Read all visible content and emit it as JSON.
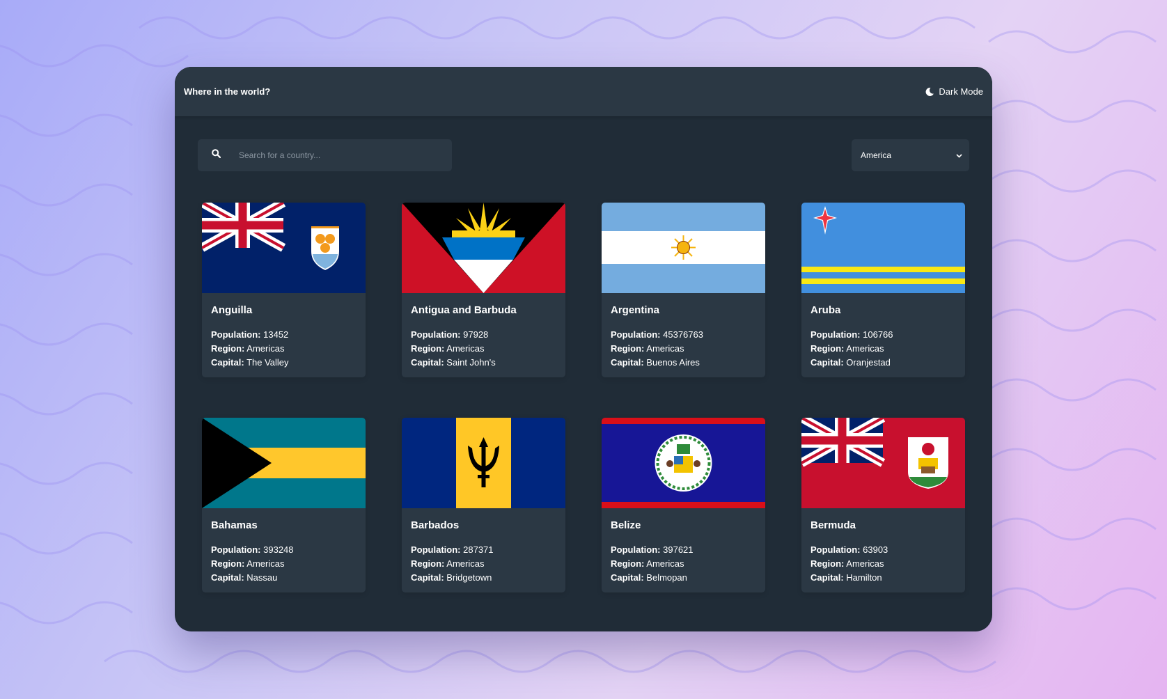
{
  "header": {
    "title": "Where in the world?",
    "mode_label": "Dark Mode"
  },
  "search": {
    "placeholder": "Search for a country..."
  },
  "filter": {
    "selected": "America"
  },
  "labels": {
    "population": "Population:",
    "region": "Region:",
    "capital": "Capital:"
  },
  "countries": [
    {
      "name": "Anguilla",
      "population": "13452",
      "region": "Americas",
      "capital": "The Valley"
    },
    {
      "name": "Antigua and Barbuda",
      "population": "97928",
      "region": "Americas",
      "capital": "Saint John's"
    },
    {
      "name": "Argentina",
      "population": "45376763",
      "region": "Americas",
      "capital": "Buenos Aires"
    },
    {
      "name": "Aruba",
      "population": "106766",
      "region": "Americas",
      "capital": "Oranjestad"
    },
    {
      "name": "Bahamas",
      "population": "393248",
      "region": "Americas",
      "capital": "Nassau"
    },
    {
      "name": "Barbados",
      "population": "287371",
      "region": "Americas",
      "capital": "Bridgetown"
    },
    {
      "name": "Belize",
      "population": "397621",
      "region": "Americas",
      "capital": "Belmopan"
    },
    {
      "name": "Bermuda",
      "population": "63903",
      "region": "Americas",
      "capital": "Hamilton"
    }
  ],
  "icons": {
    "mode": "moon-icon",
    "search": "search-icon",
    "select": "chevron-down-icon"
  },
  "colors": {
    "background": "#202c37",
    "element": "#2b3844",
    "text": "#ffffff"
  }
}
